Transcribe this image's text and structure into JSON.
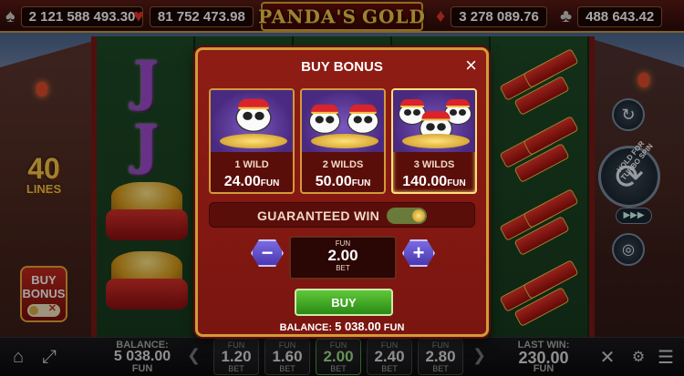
{
  "jackpots": [
    {
      "suit": "♠",
      "value": "2 121 588 493.30"
    },
    {
      "suit": "♥",
      "value": "81 752 473.98"
    },
    {
      "suit": "♦",
      "value": "3 278 089.76"
    },
    {
      "suit": "♣",
      "value": "488 643.42"
    }
  ],
  "logo": {
    "left": "PANDA'S",
    "right": "GOLD"
  },
  "side": {
    "lines_num": "40",
    "lines_label": "LINES",
    "buy_bonus_line1": "BUY",
    "buy_bonus_line2": "BONUS",
    "turbo_hint": "HOLD FOR TURBO SPIN",
    "ffw": "▶▶▶"
  },
  "reel_symbols": {
    "j": "J"
  },
  "modal": {
    "title": "BUY BONUS",
    "close": "×",
    "options": [
      {
        "label": "1 WILD",
        "price": "24.00",
        "currency": "FUN"
      },
      {
        "label": "2 WILDS",
        "price": "50.00",
        "currency": "FUN"
      },
      {
        "label": "3 WILDS",
        "price": "140.00",
        "currency": "FUN"
      }
    ],
    "guaranteed_label": "GUARANTEED WIN",
    "bet": {
      "currency": "FUN",
      "value": "2.00",
      "label": "BET"
    },
    "minus": "−",
    "plus": "+",
    "buy_label": "BUY",
    "balance_label": "BALANCE:",
    "balance_value": "5 038.00",
    "balance_currency": "FUN"
  },
  "bottom": {
    "balance_label": "BALANCE:",
    "balance_value": "5 038.00",
    "balance_currency": "FUN",
    "last_win_label": "LAST WIN:",
    "last_win_value": "230.00",
    "last_win_currency": "FUN",
    "bets": [
      {
        "currency": "FUN",
        "value": "1.20",
        "label": "BET"
      },
      {
        "currency": "FUN",
        "value": "1.60",
        "label": "BET"
      },
      {
        "currency": "FUN",
        "value": "2.00",
        "label": "BET"
      },
      {
        "currency": "FUN",
        "value": "2.40",
        "label": "BET"
      },
      {
        "currency": "FUN",
        "value": "2.80",
        "label": "BET"
      }
    ],
    "chev_left": "❮",
    "chev_right": "❯"
  },
  "colors": {
    "accent_gold": "#d39a3a",
    "modal_red": "#8e1d14",
    "buy_green": "#3aa020",
    "stepper_purple": "#5a48c8"
  }
}
